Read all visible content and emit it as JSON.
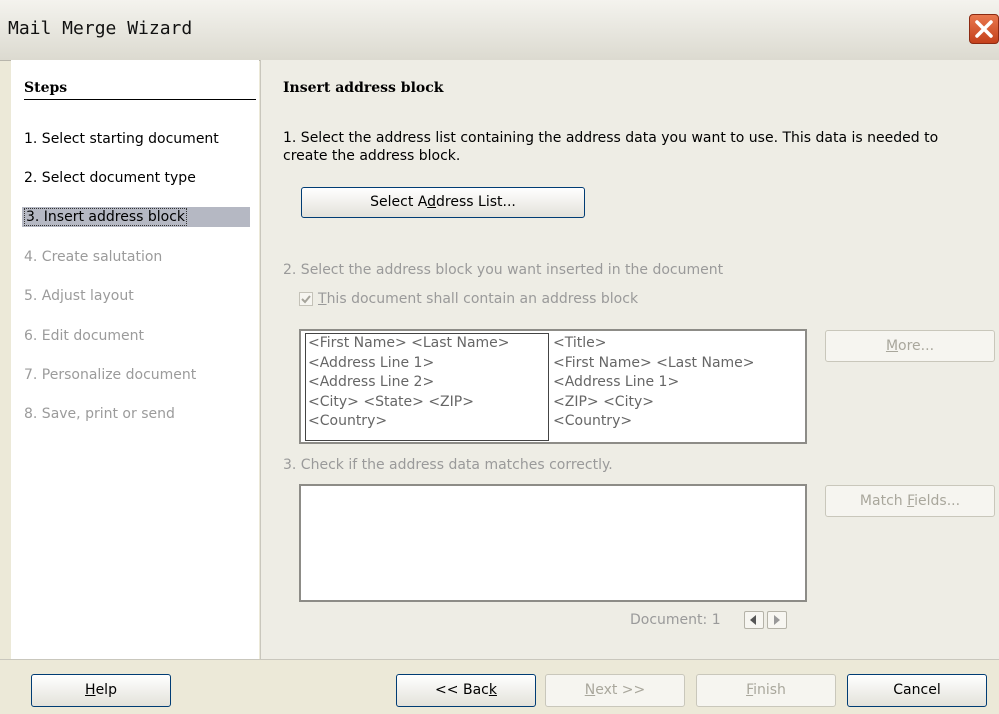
{
  "window": {
    "title": "Mail Merge Wizard"
  },
  "steps": {
    "heading": "Steps",
    "items": [
      {
        "label": "1. Select starting document",
        "state": "enabled"
      },
      {
        "label": "2. Select document type",
        "state": "enabled"
      },
      {
        "label": "3. Insert address block",
        "state": "active"
      },
      {
        "label": "4. Create salutation",
        "state": "disabled"
      },
      {
        "label": "5. Adjust layout",
        "state": "disabled"
      },
      {
        "label": "6. Edit document",
        "state": "disabled"
      },
      {
        "label": "7. Personalize document",
        "state": "disabled"
      },
      {
        "label": "8. Save, print or send",
        "state": "disabled"
      }
    ]
  },
  "main": {
    "heading": "Insert address block",
    "instruction1_line1": "1. Select the address list containing the address data you want to use. This data is needed to",
    "instruction1_line2": "create the address block.",
    "select_address_list_button": {
      "pre": "Select A",
      "mnemonic": "d",
      "post": "dress List..."
    },
    "instruction2": "2. Select the address block you want inserted in the document",
    "checkbox": {
      "mnemonic": "T",
      "rest": "his document shall contain an address block",
      "checked": true
    },
    "address_block_1": [
      "<First Name> <Last Name>",
      "<Address Line 1>",
      "<Address Line 2>",
      "<City> <State> <ZIP>",
      "<Country>"
    ],
    "address_block_2": [
      "<Title>",
      "<First Name> <Last Name>",
      "<Address Line 1>",
      "<ZIP> <City>",
      "<Country>"
    ],
    "more_button": {
      "mnemonic": "M",
      "rest": "ore..."
    },
    "instruction3": "3. Check if the address data matches correctly.",
    "match_fields_button": {
      "pre": "Match ",
      "mnemonic": "F",
      "rest": "ields..."
    },
    "document_label": "Document: 1"
  },
  "footer": {
    "help": {
      "mnemonic": "H",
      "rest": "elp"
    },
    "back": {
      "pre": "<< Bac",
      "mnemonic": "k"
    },
    "next": {
      "mnemonic": "N",
      "rest": "ext >>"
    },
    "finish": {
      "mnemonic": "F",
      "rest": "inish"
    },
    "cancel": "Cancel"
  },
  "colors": {
    "active_step_bg": "#b5b8c3",
    "disabled_text": "#9b9b9b",
    "close_button": "#d9532c"
  },
  "icons": {
    "close": "close-icon",
    "checkbox": "checkmark-icon",
    "prev": "triangle-left-icon",
    "next": "triangle-right-icon"
  }
}
